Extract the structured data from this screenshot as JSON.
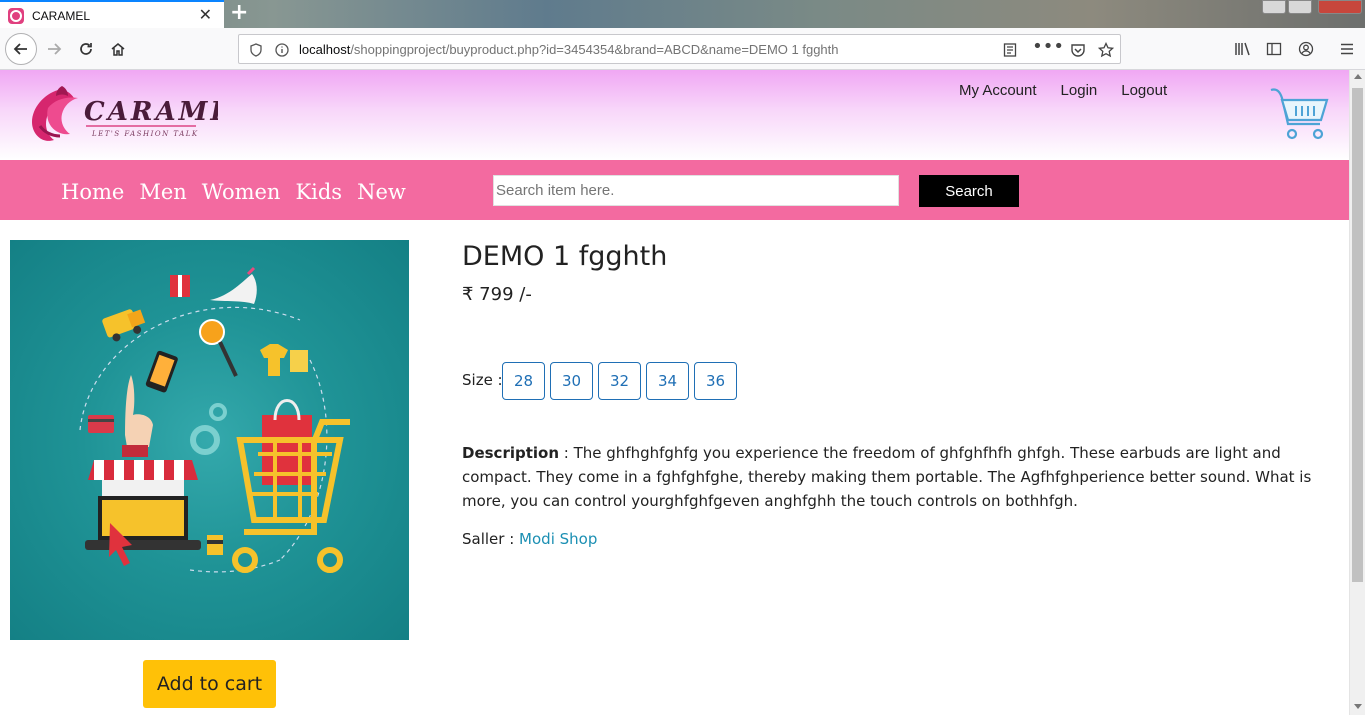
{
  "browser": {
    "tab_title": "CARAMEL",
    "url_host": "localhost",
    "url_path": "/shoppingproject/buyproduct.php?id=3454354&brand=ABCD&name=DEMO 1 fgghth"
  },
  "header": {
    "logo_text": "CARAMEL",
    "logo_tagline": "LET'S FASHION TALK",
    "links": [
      "My Account",
      "Login",
      "Logout"
    ]
  },
  "menu": {
    "items": [
      "Home",
      "Men",
      "Women",
      "Kids",
      "New"
    ],
    "search_placeholder": "Search item here.",
    "search_button": "Search"
  },
  "product": {
    "title": "DEMO 1 fgghth",
    "price": "₹ 799 /-",
    "size_label": "Size :",
    "sizes": [
      "28",
      "30",
      "32",
      "34",
      "36"
    ],
    "description_label": "Description",
    "description_text": " : The ghfhghfghfg you experience the freedom of ghfghfhfh ghfgh. These earbuds are light and compact. They come in a fghfghfghe, thereby making them portable. The Agfhfghperience better sound. What is more, you can control yourghfghfgeven anghfghh the touch controls on bothhfgh.",
    "seller_label": "Saller : ",
    "seller_name": "Modi Shop",
    "add_to_cart": "Add to cart"
  },
  "colors": {
    "menu_bar": "#f36aa0",
    "accent_button": "#ffc107",
    "size_border": "#1f6fb5",
    "seller_link": "#1b8fb3"
  }
}
